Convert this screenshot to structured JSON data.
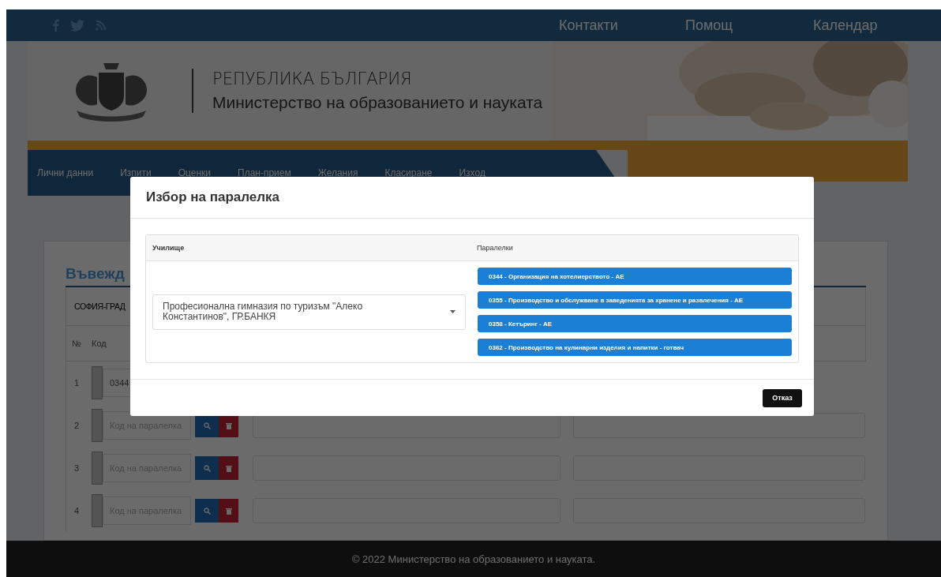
{
  "top_links": [
    "Контакти",
    "Помощ",
    "Календар"
  ],
  "header": {
    "title": "РЕПУБЛИКА БЪЛГАРИЯ",
    "subtitle": "Министерство на образованието и науката"
  },
  "nav": [
    "Лични данни",
    "Изпити",
    "Оценки",
    "План-прием",
    "Желания",
    "Класиране",
    "Изход"
  ],
  "form": {
    "title": "Въвежд",
    "region_tab": "СОФИЯ-ГРАД",
    "columns": [
      "№",
      "Код"
    ],
    "rows": [
      {
        "number": "1",
        "code": "0344"
      },
      {
        "number": "2",
        "placeholder": "Код на паралелка"
      },
      {
        "number": "3",
        "placeholder": "Код на паралелка"
      },
      {
        "number": "4",
        "placeholder": "Код на паралелка"
      }
    ]
  },
  "modal": {
    "title": "Избор на паралелка",
    "school_column": "Училище",
    "classes_column": "Паралелки",
    "school_select": {
      "value": "Професионална гимназия по туризъм \"Алеко Константинов\", ГР.БАНКЯ"
    },
    "classes": [
      "0344 - Организация на хотелиерството - АЕ",
      "0355 - Производство и обслужване в заведенията за хранене и развлечения - АЕ",
      "0358 - Кетъринг - АЕ",
      "0362 - Производство на кулинарни изделия и напитки - готвач"
    ],
    "cancel_button": "Отказ"
  },
  "footer": "© 2022 Министерство на образованието и науката."
}
